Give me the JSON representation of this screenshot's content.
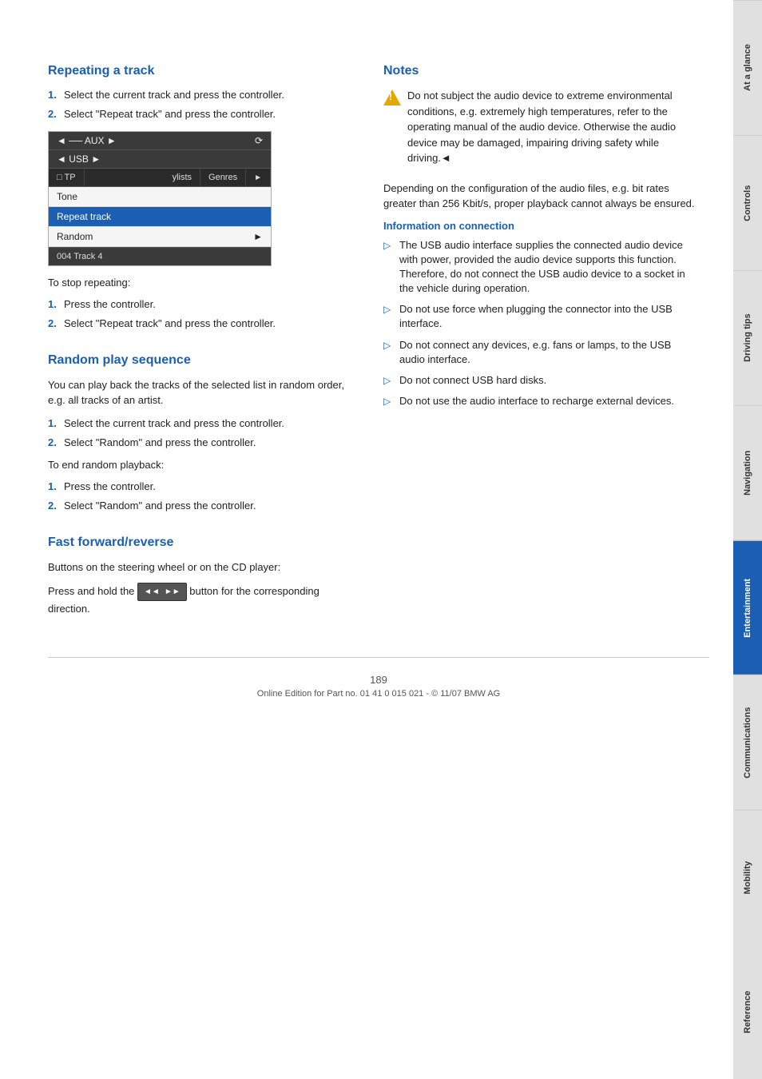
{
  "page": {
    "number": "189",
    "footer_text": "Online Edition for Part no. 01 41 0 015 021 - © 11/07 BMW AG"
  },
  "side_tabs": [
    {
      "label": "At a glance",
      "active": false
    },
    {
      "label": "Controls",
      "active": false
    },
    {
      "label": "Driving tips",
      "active": false
    },
    {
      "label": "Navigation",
      "active": false
    },
    {
      "label": "Entertainment",
      "active": true
    },
    {
      "label": "Communications",
      "active": false
    },
    {
      "label": "Mobility",
      "active": false
    },
    {
      "label": "Reference",
      "active": false
    }
  ],
  "left_column": {
    "repeating_title": "Repeating a track",
    "repeating_steps": [
      {
        "num": "1.",
        "text": "Select the current track and press the controller."
      },
      {
        "num": "2.",
        "text": "Select \"Repeat track\" and press the controller."
      }
    ],
    "ui": {
      "topbar_left": "◄ ── AUX ►",
      "topbar_right": "⟳",
      "secondbar": "◄ USB ►",
      "tp_label": "□ TP",
      "menu_ylists": "ylists",
      "menu_genres": "Genres",
      "menu_arrow": "►",
      "rows": [
        {
          "label": "Tone",
          "selected": false
        },
        {
          "label": "Repeat track",
          "selected": true
        },
        {
          "label": "Random",
          "selected": false,
          "arrow": "►"
        }
      ],
      "track_label": "004 Track 4"
    },
    "stop_repeat_text": "To stop repeating:",
    "stop_steps": [
      {
        "num": "1.",
        "text": "Press the controller."
      },
      {
        "num": "2.",
        "text": "Select \"Repeat track\" and press the controller."
      }
    ],
    "random_title": "Random play sequence",
    "random_intro": "You can play back the tracks of the selected list in random order, e.g. all tracks of an artist.",
    "random_steps": [
      {
        "num": "1.",
        "text": "Select the current track and press the controller."
      },
      {
        "num": "2.",
        "text": "Select \"Random\" and press the controller."
      }
    ],
    "end_random_text": "To end random playback:",
    "end_random_steps": [
      {
        "num": "1.",
        "text": "Press the controller."
      },
      {
        "num": "2.",
        "text": "Select \"Random\" and press the controller."
      }
    ],
    "fast_title": "Fast forward/reverse",
    "fast_intro": "Buttons on the steering wheel or on the CD player:",
    "fast_detail_prefix": "Press and hold the",
    "fast_detail_suffix": "button for the corresponding direction."
  },
  "right_column": {
    "notes_title": "Notes",
    "warning_text": "Do not subject the audio device to extreme environmental conditions, e.g. extremely high temperatures, refer to the operating manual of the audio device. Otherwise the audio device may be damaged, impairing driving safety while driving.◄",
    "note_para2": "Depending on the configuration of the audio files, e.g. bit rates greater than 256 Kbit/s, proper playback cannot always be ensured.",
    "info_connection_title": "Information on connection",
    "bullet_items": [
      "The USB audio interface supplies the connected audio device with power, provided the audio device supports this function. Therefore, do not connect the USB audio device to a socket in the vehicle during operation.",
      "Do not use force when plugging the connector into the USB interface.",
      "Do not connect any devices, e.g. fans or lamps, to the USB audio interface.",
      "Do not connect USB hard disks.",
      "Do not use the audio interface to recharge external devices."
    ]
  }
}
